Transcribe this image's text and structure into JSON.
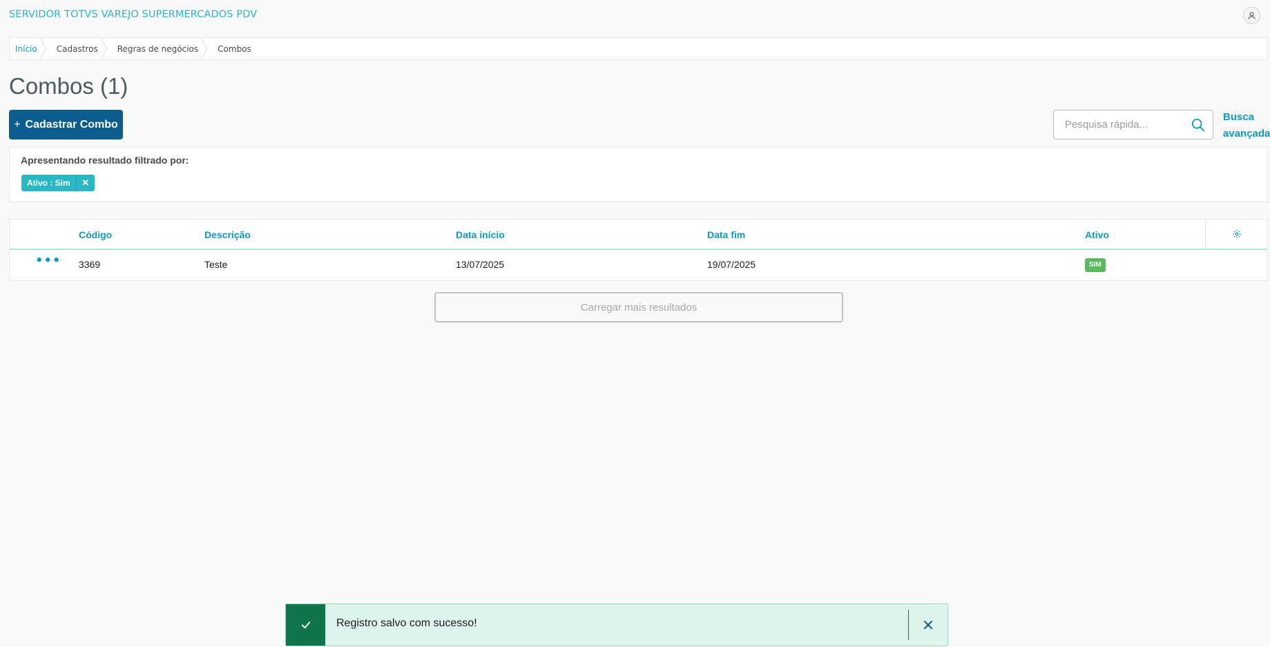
{
  "app": {
    "title": "SERVIDOR TOTVS VAREJO SUPERMERCADOS PDV",
    "user_icon": "user-icon"
  },
  "breadcrumb": [
    "Início",
    "Cadastros",
    "Regras de negócios",
    "Combos"
  ],
  "page": {
    "title": "Combos (1)"
  },
  "actions": {
    "create_label": "Cadastrar Combo",
    "create_icon": "plus-icon"
  },
  "search": {
    "placeholder": "Pesquisa rápida...",
    "value": "",
    "advanced_label_line1": "Busca",
    "advanced_label_line2": "avançada"
  },
  "filter": {
    "label": "Apresentando resultado filtrado por:",
    "chips": [
      {
        "label": "Ativo : Sim"
      }
    ]
  },
  "table": {
    "columns": [
      "Código",
      "Descrição",
      "Data início",
      "Data fim",
      "Ativo"
    ],
    "rows": [
      {
        "codigo": "3369",
        "descricao": "Teste",
        "data_inicio": "13/07/2025",
        "data_fim": "19/07/2025",
        "ativo": "SIM"
      }
    ]
  },
  "load_more_label": "Carregar mais resultados",
  "toast": {
    "message": "Registro salvo com sucesso!",
    "type": "success"
  },
  "colors": {
    "accent": "#29b6c5",
    "link": "#0c9abe",
    "primary": "#0b5c8f",
    "success": "#10754a",
    "badge_success": "#5cb85c"
  }
}
